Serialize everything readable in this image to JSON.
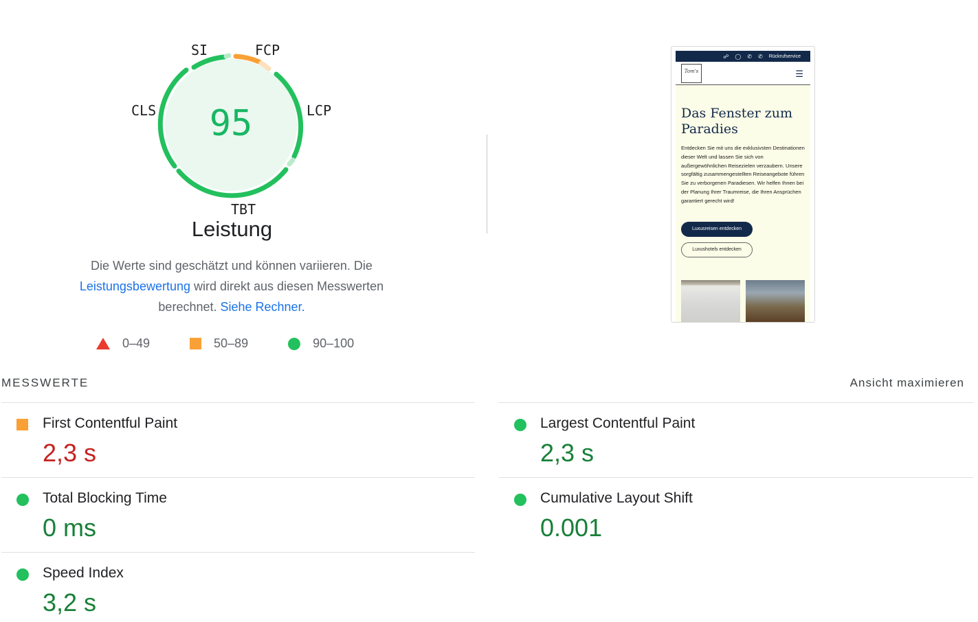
{
  "gauge": {
    "score": "95",
    "title": "Leistung",
    "labels": {
      "si": "SI",
      "fcp": "FCP",
      "lcp": "LCP",
      "tbt": "TBT",
      "cls": "CLS"
    }
  },
  "description": {
    "part1": "Die Werte sind geschätzt und können variieren. Die",
    "link1": "Leistungsbewertung",
    "part2": " wird direkt aus diesen Messwerten",
    "part3": "berechnet. ",
    "link2": "Siehe Rechner."
  },
  "legend": [
    {
      "icon": "triangle-red",
      "label": "0–49"
    },
    {
      "icon": "square-orange",
      "label": "50–89"
    },
    {
      "icon": "circle-green",
      "label": "90–100"
    }
  ],
  "preview": {
    "topbar_label": "Rückrufservice",
    "logo_text": "Tom's",
    "headline": "Das Fenster zum Paradies",
    "paragraph": "Entdecken Sie mit uns die exklusivsten Destinationen dieser Welt und lassen Sie sich von außergewöhnlichen Reisezielen verzaubern. Unsere sorgfältig zusammengestellten Reiseangebote führen Sie zu verborgenen Paradiesen. Wir helfen Ihnen bei der Planung Ihrer Traumreise, die Ihren Ansprüchen garantiert gerecht wird!",
    "button1": "Luxusreisen entdecken",
    "button2": "Luxushotels entdecken"
  },
  "metrics_section": {
    "title": "MESSWERTE",
    "maximize": "Ansicht maximieren"
  },
  "metrics": [
    {
      "name": "First Contentful Paint",
      "value": "2,3 s",
      "rating": "average"
    },
    {
      "name": "Largest Contentful Paint",
      "value": "2,3 s",
      "rating": "good"
    },
    {
      "name": "Total Blocking Time",
      "value": "0 ms",
      "rating": "good"
    },
    {
      "name": "Cumulative Layout Shift",
      "value": "0.001",
      "rating": "good"
    },
    {
      "name": "Speed Index",
      "value": "3,2 s",
      "rating": "good"
    }
  ],
  "colors": {
    "good": "#23c05e",
    "average": "#f9a136",
    "poor": "#eb3a2e",
    "value_red": "#c5221f",
    "value_green": "#188038",
    "link": "#1a73e8"
  }
}
